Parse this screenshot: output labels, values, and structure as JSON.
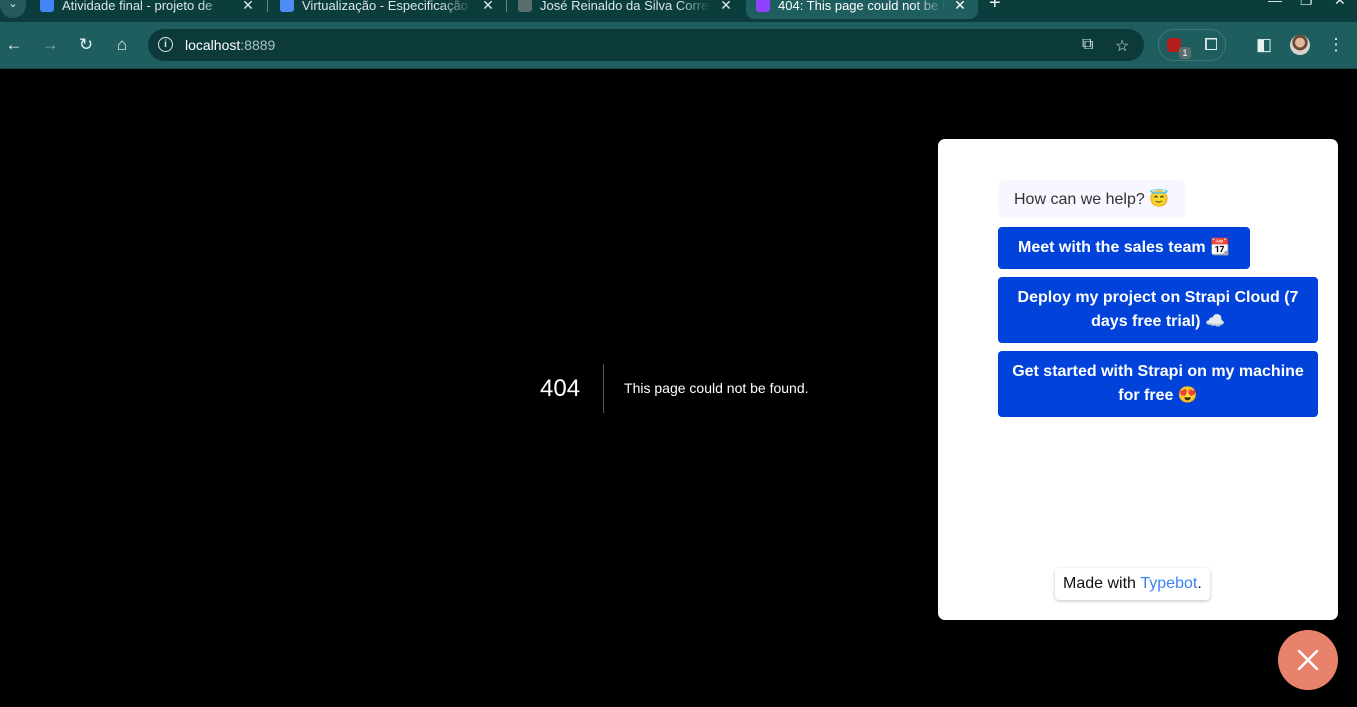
{
  "browser": {
    "tabs": [
      {
        "title": "Atividade final - projeto de",
        "favicon_color": "#4285f4",
        "active": false
      },
      {
        "title": "Virtualização - Especificação",
        "favicon_color": "#4f8bf5",
        "active": false
      },
      {
        "title": "José Reinaldo da Silva Corre",
        "favicon_color": "#5a6e6e",
        "active": false
      },
      {
        "title": "404: This page could not be f",
        "favicon_color": "#8e44ff",
        "active": true
      }
    ],
    "close_glyph": "✕",
    "new_tab_glyph": "+",
    "url_host": "localhost",
    "url_port": ":8889",
    "extension_badge": "1"
  },
  "page": {
    "error_code": "404",
    "error_message": "This page could not be found."
  },
  "chatbot": {
    "greeting": "How can we help? 😇",
    "choices": [
      "Meet with the sales team 📆",
      "Deploy my project on Strapi Cloud (7 days free trial) ☁️",
      "Get started with Strapi on my machine for free 😍"
    ],
    "branding_prefix": "Made with ",
    "branding_link": "Typebot",
    "branding_suffix": "."
  },
  "colors": {
    "chrome_dark": "#0b3d3d",
    "chrome_toolbar": "#1e5e5e",
    "button_blue": "#0042da",
    "fab_color": "#e8826a"
  }
}
